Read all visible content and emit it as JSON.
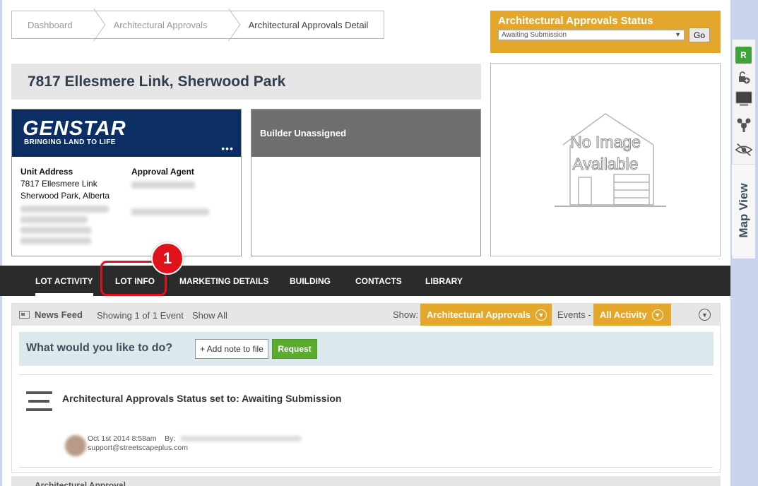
{
  "breadcrumb": [
    "Dashboard",
    "Architectural Approvals",
    "Architectural Approvals Detail"
  ],
  "status": {
    "title": "Architectural Approvals Status",
    "selected": "Awaiting Submission",
    "go_label": "Go"
  },
  "address": "7817 Ellesmere Link, Sherwood Park",
  "builder_card": {
    "logo": "GENSTAR",
    "tagline": "BRINGING LAND TO LIFE",
    "menu": "•••",
    "unit_address_label": "Unit Address",
    "unit_address_line1": "7817 Ellesmere Link",
    "unit_address_line2": "Sherwood Park, Alberta",
    "approval_agent_label": "Approval Agent"
  },
  "builder_status": "Builder Unassigned",
  "no_image_text": [
    "No Image",
    "Available"
  ],
  "nav": {
    "items": [
      "LOT ACTIVITY",
      "LOT INFO",
      "MARKETING DETAILS",
      "BUILDING",
      "CONTACTS",
      "LIBRARY"
    ],
    "active": "LOT ACTIVITY",
    "highlighted": "LOT INFO"
  },
  "step_badge": "1",
  "feed": {
    "title": "News Feed",
    "showing": "Showing 1 of 1 Event",
    "show_all": "Show All",
    "show_label": "Show:",
    "filter": "Architectural Approvals",
    "events_label": "Events -",
    "events_filter": "All Activity",
    "todo_question": "What would you like to do?",
    "add_note": "+ Add note to file",
    "request": "Request",
    "activity_title": "Architectural Approvals Status set to: Awaiting Submission",
    "activity_date": "Oct 1st 2014 8:58am",
    "activity_by": "By:",
    "activity_email": "support@streetscapeplus.com",
    "next_section": "Architectural Approval"
  },
  "right_panel": {
    "r_button": "R",
    "map_view": "Map View"
  },
  "colors": {
    "accent": "#e2a72b",
    "nav_bg": "#2b2b2b",
    "brand_navy": "#0b2e63",
    "highlight_red": "#e0121b",
    "request_green": "#5aab2e"
  }
}
